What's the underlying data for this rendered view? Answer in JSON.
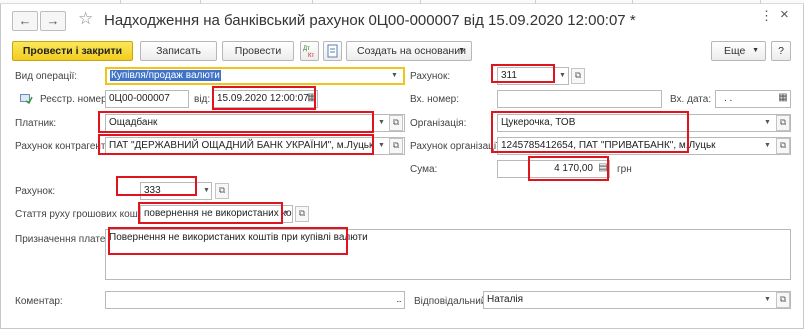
{
  "window": {
    "title": "Надходження на банківський рахунок 0Ц00-000007 від 15.09.2020 12:00:07 *",
    "back_icon": "arrow-left-icon",
    "forward_icon": "arrow-right-icon",
    "favorite_icon": "star-icon",
    "more_glyph": "⋮",
    "close_glyph": "×"
  },
  "toolbar": {
    "post_and_close": "Провести і закрити",
    "save": "Записать",
    "post": "Провести",
    "create_based_on": "Создать на основании",
    "more": "Еще",
    "help": "?"
  },
  "form": {
    "operation_type": {
      "label": "Вид операції:",
      "value": "Купівля/продаж валюти"
    },
    "reg_number": {
      "label": "Реєстр. номер:",
      "value": "0Ц00-000007"
    },
    "date": {
      "label": "від:",
      "value": "15.09.2020 12:00:07"
    },
    "account_top": {
      "label": "Рахунок:",
      "value": "311"
    },
    "incoming_number": {
      "label": "Вх. номер:",
      "value": ""
    },
    "incoming_date": {
      "label": "Вх. дата:",
      "value": ". ."
    },
    "payer": {
      "label": "Платник:",
      "value": "Ощадбанк"
    },
    "counterparty_account": {
      "label": "Рахунок контрагента:",
      "value": "ПАТ \"ДЕРЖАВНИЙ ОЩАДНИЙ БАНК УКРАЇНИ\", м.Луцьк"
    },
    "organization": {
      "label": "Організація:",
      "value": "Цукерочка, ТОВ"
    },
    "organization_account": {
      "label": "Рахунок організації:",
      "value": "1245785412654, ПАТ \"ПРИВАТБАНК\", м.Луцьк"
    },
    "sum": {
      "label": "Сума:",
      "value": "4 170,00",
      "currency": "грн"
    },
    "account_mid": {
      "label": "Рахунок:",
      "value": "333"
    },
    "cash_flow_item": {
      "label": "Стаття руху грошових коштів:",
      "value": "повернення не використаних кош"
    },
    "payment_purpose": {
      "label": "Призначення платежу:",
      "value": "Повернення не використаних коштів при купівлі валюти"
    },
    "comment": {
      "label": "Коментар:",
      "value": ""
    },
    "responsible": {
      "label": "Відповідальний:",
      "value": "Наталія"
    }
  },
  "colors": {
    "highlight_red": "#e0141e",
    "primary_button": "#f2cc1f",
    "selection_blue": "#3e73c7",
    "focus_yellow": "#f0c419"
  }
}
